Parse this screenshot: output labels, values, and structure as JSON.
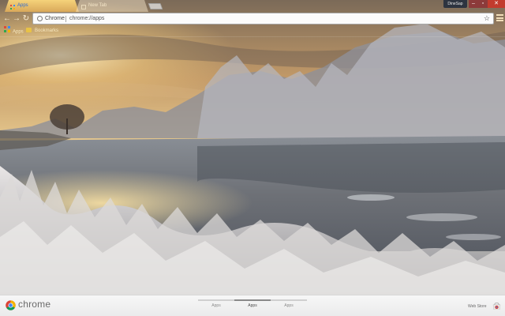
{
  "window": {
    "user_name": "DineSap",
    "minimize_icon": "minimize-icon",
    "maximize_icon": "maximize-icon",
    "close_icon": "close-icon"
  },
  "tabs": [
    {
      "label": "Apps",
      "active": true,
      "icon": "apps-grid-icon"
    },
    {
      "label": "New Tab",
      "active": false,
      "icon": "page-icon"
    }
  ],
  "toolbar": {
    "back_icon": "back-arrow-icon",
    "forward_icon": "forward-arrow-icon",
    "reload_icon": "reload-icon",
    "omnibox": {
      "chip": "Chrome",
      "url": "chrome://apps",
      "star_icon": "star-icon"
    },
    "menu_icon": "hamburger-menu-icon"
  },
  "bookmarks": [
    {
      "label": "Apps",
      "icon": "apps-grid-icon"
    },
    {
      "label": "Bookmarks",
      "icon": "folder-icon"
    }
  ],
  "bottom_bar": {
    "brand": "chrome",
    "pages": [
      {
        "label": "Apps",
        "active": false
      },
      {
        "label": "Apps",
        "active": true
      },
      {
        "label": "Apps",
        "active": false
      }
    ],
    "web_store": "Web Store",
    "web_store_icon": "web-store-icon"
  },
  "colors": {
    "tab_active": "#f5d27a",
    "close_button": "#c23b2e",
    "omnibox_bg": "#fbfbfb",
    "bottom_bar_bg": "#f4f4f4"
  }
}
